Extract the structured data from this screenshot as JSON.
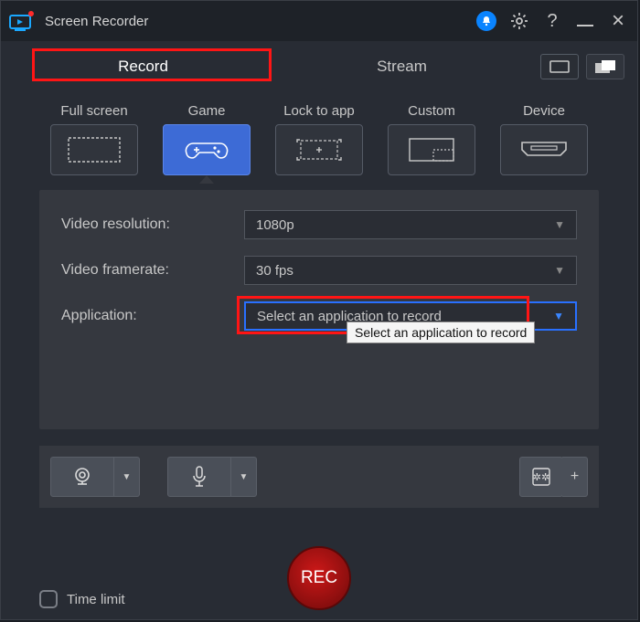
{
  "app": {
    "title": "Screen Recorder"
  },
  "tabs": {
    "record": "Record",
    "stream": "Stream"
  },
  "capture": {
    "full_screen": "Full screen",
    "game": "Game",
    "lock_to_app": "Lock to app",
    "custom": "Custom",
    "device": "Device"
  },
  "settings": {
    "resolution_label": "Video resolution:",
    "resolution_value": "1080p",
    "framerate_label": "Video framerate:",
    "framerate_value": "30 fps",
    "application_label": "Application:",
    "application_value": "Select an application to record",
    "application_tooltip": "Select an application to record"
  },
  "footer": {
    "time_limit": "Time limit",
    "rec": "REC"
  }
}
